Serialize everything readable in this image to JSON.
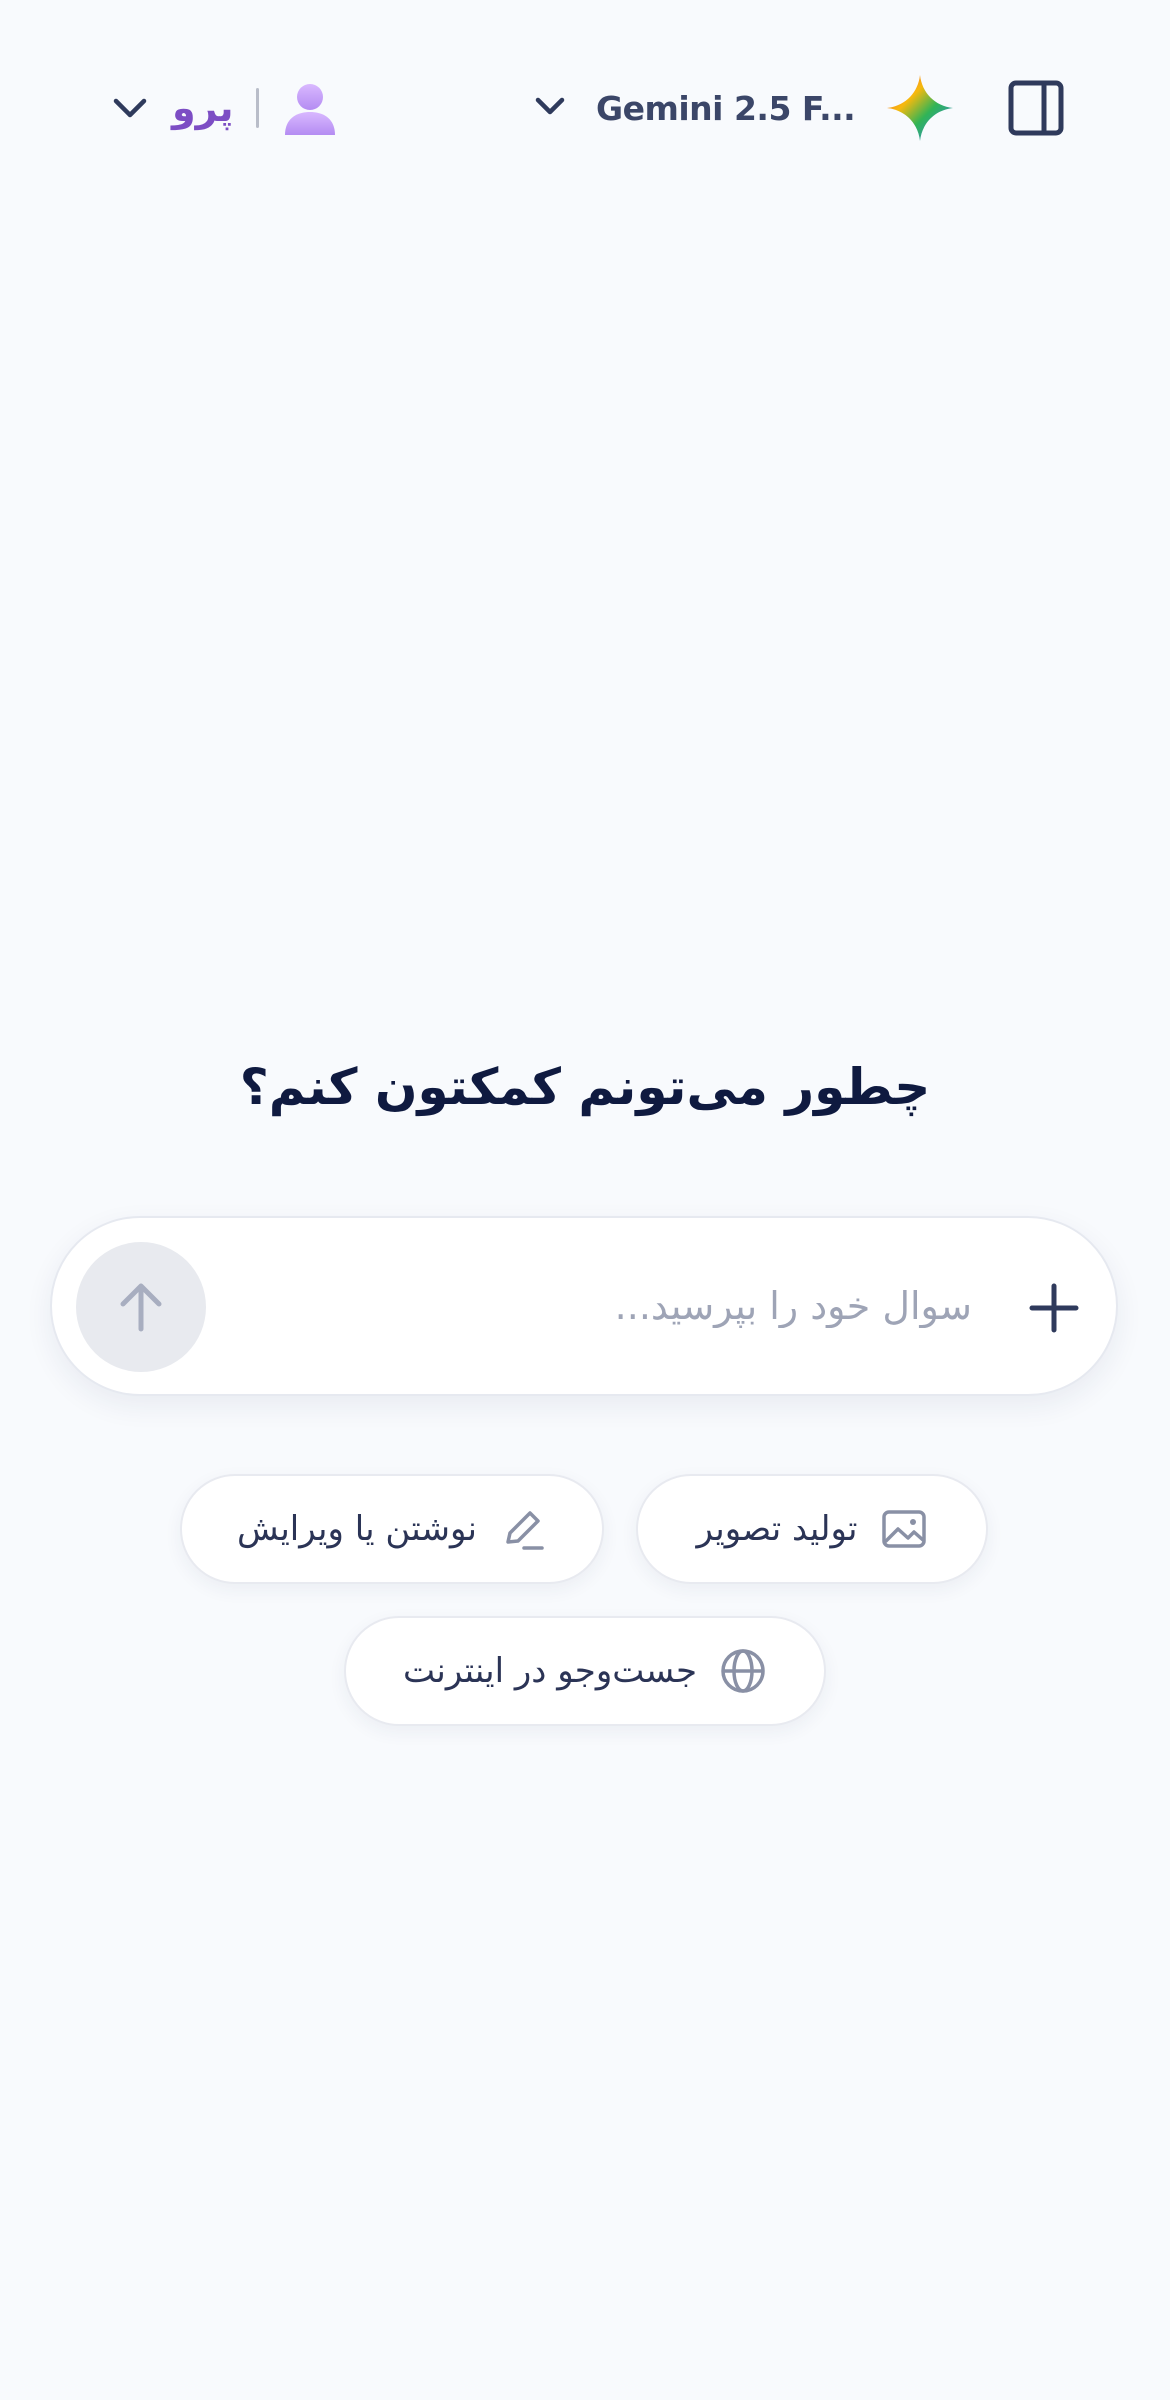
{
  "header": {
    "plan_label": "پرو",
    "model_name": "Gemini 2.5 F...",
    "icons": {
      "account_chevron": "chevron-down-icon",
      "avatar": "user-avatar-icon",
      "model_chevron": "chevron-down-icon",
      "model_logo": "gemini-sparkle-icon",
      "sidebar": "sidebar-toggle-icon"
    }
  },
  "main": {
    "greeting": "چطور می‌تونم کمکتون کنم؟",
    "composer": {
      "placeholder": "سوال خود را بپرسید...",
      "value": "",
      "send_icon": "arrow-up-icon",
      "attach_icon": "plus-icon"
    },
    "chips": [
      {
        "label": "تولید تصویر",
        "icon": "image-icon"
      },
      {
        "label": "نوشتن یا ویرایش",
        "icon": "pencil-icon"
      },
      {
        "label": "جست‌وجو در اینترنت",
        "icon": "globe-icon"
      }
    ]
  },
  "colors": {
    "background": "#f8fafd",
    "plan_accent": "#7c4dc4",
    "heading": "#0f1a40",
    "icon": "#2f3a5c",
    "send_button_disabled": "#e8eaef"
  }
}
